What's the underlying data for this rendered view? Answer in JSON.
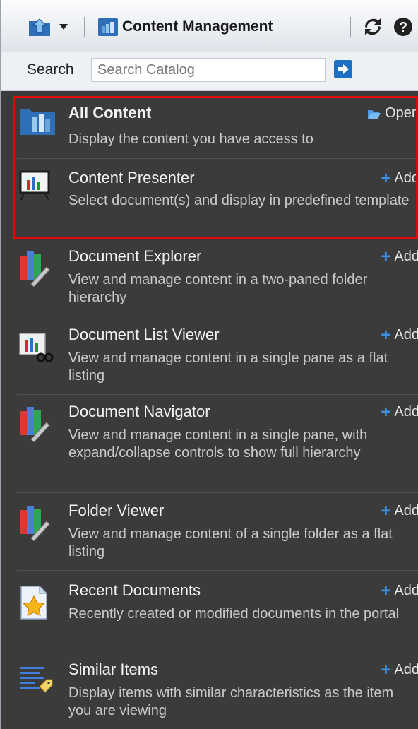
{
  "toolbar": {
    "title": "Content Management",
    "icons": [
      "home-folder-icon",
      "dropdown-arrow-icon",
      "content-management-icon",
      "refresh-icon",
      "help-icon"
    ]
  },
  "search": {
    "label": "Search",
    "placeholder": "Search Catalog"
  },
  "items": [
    {
      "title": "All Content",
      "desc": "Display the content you have access to",
      "action": "Open",
      "icon": "all-content-icon"
    },
    {
      "title": "Content Presenter",
      "desc": "Select document(s) and display in predefined template",
      "action": "Add",
      "icon": "presenter-icon"
    },
    {
      "title": "Document Explorer",
      "desc": "View and manage content in a two-paned folder hierarchy",
      "action": "Add",
      "icon": "books-tools-icon"
    },
    {
      "title": "Document List Viewer",
      "desc": "View and manage content in a single pane as a flat listing",
      "action": "Add",
      "icon": "list-viewer-icon"
    },
    {
      "title": "Document Navigator",
      "desc": "View and manage content in a single pane, with expand/collapse controls to show full hierarchy",
      "action": "Add",
      "icon": "books-tools-icon"
    },
    {
      "title": "Folder Viewer",
      "desc": "View and manage content of a single folder as a flat listing",
      "action": "Add",
      "icon": "books-tools-icon"
    },
    {
      "title": "Recent Documents",
      "desc": "Recently created or modified documents in the portal",
      "action": "Add",
      "icon": "recent-star-icon"
    },
    {
      "title": "Similar Items",
      "desc": "Display items with similar characteristics as the item you are viewing",
      "action": "Add",
      "icon": "similar-items-icon"
    }
  ],
  "colors": {
    "accent": "#1d6fc4",
    "highlight": "#e3060b",
    "list_bg": "#3b3b3b"
  }
}
